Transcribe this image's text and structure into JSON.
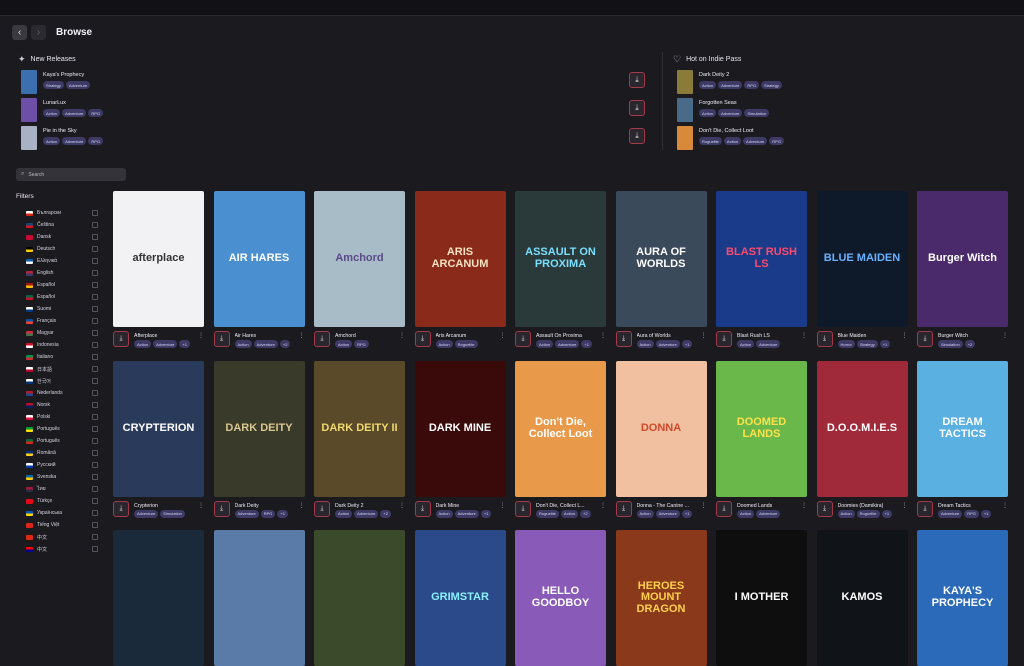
{
  "header": {
    "title": "Browse",
    "back_icon": "‹",
    "forward_icon": "›"
  },
  "new_releases": {
    "title": "New Releases",
    "items": [
      {
        "title": "Kaya's Prophecy",
        "tags": [
          "Strategy",
          "Adventure"
        ],
        "color": "#3b6fb0"
      },
      {
        "title": "LunarLux",
        "tags": [
          "Action",
          "Adventure",
          "RPG"
        ],
        "color": "#6d4fa8"
      },
      {
        "title": "Pie in the Sky",
        "tags": [
          "Action",
          "Adventure",
          "RPG"
        ],
        "color": "#a8b2c4"
      }
    ]
  },
  "indie_pass": {
    "title": "Hot on Indie Pass",
    "items": [
      {
        "title": "Dark Deity 2",
        "tags": [
          "Action",
          "Adventure",
          "RPG",
          "Strategy"
        ],
        "color": "#8b7b3a"
      },
      {
        "title": "Forgotten Seas",
        "tags": [
          "Action",
          "Adventure",
          "Simulation"
        ],
        "color": "#4a6a8a"
      },
      {
        "title": "Don't Die, Collect Loot",
        "tags": [
          "Roguelite",
          "Action",
          "Adventure",
          "RPG"
        ],
        "color": "#d88a3a"
      }
    ]
  },
  "search": {
    "placeholder": "Search"
  },
  "filters": {
    "title": "Filters",
    "languages": [
      {
        "label": "Български",
        "c1": "#ffffff",
        "c2": "#d62612"
      },
      {
        "label": "Čeština",
        "c1": "#11457e",
        "c2": "#d7141a"
      },
      {
        "label": "Dansk",
        "c1": "#c60c30",
        "c2": "#c60c30"
      },
      {
        "label": "Deutsch",
        "c1": "#000000",
        "c2": "#ffce00"
      },
      {
        "label": "Ελληνικά",
        "c1": "#0d5eaf",
        "c2": "#ffffff"
      },
      {
        "label": "English",
        "c1": "#b22234",
        "c2": "#3c3b6e"
      },
      {
        "label": "Español",
        "c1": "#aa151b",
        "c2": "#f1bf00"
      },
      {
        "label": "Español",
        "c1": "#006847",
        "c2": "#ce1126"
      },
      {
        "label": "Suomi",
        "c1": "#ffffff",
        "c2": "#003580"
      },
      {
        "label": "Français",
        "c1": "#0055a4",
        "c2": "#ef4135"
      },
      {
        "label": "Magyar",
        "c1": "#ce2939",
        "c2": "#477050"
      },
      {
        "label": "Indonesia",
        "c1": "#ce1126",
        "c2": "#ffffff"
      },
      {
        "label": "Italiano",
        "c1": "#009246",
        "c2": "#ce2b37"
      },
      {
        "label": "日本語",
        "c1": "#ffffff",
        "c2": "#bc002d"
      },
      {
        "label": "한국어",
        "c1": "#ffffff",
        "c2": "#003478"
      },
      {
        "label": "Nederlands",
        "c1": "#ae1c28",
        "c2": "#21468b"
      },
      {
        "label": "Norsk",
        "c1": "#ba0c2f",
        "c2": "#00205b"
      },
      {
        "label": "Polski",
        "c1": "#ffffff",
        "c2": "#dc143c"
      },
      {
        "label": "Português",
        "c1": "#009c3b",
        "c2": "#ffdf00"
      },
      {
        "label": "Português",
        "c1": "#046a38",
        "c2": "#da291c"
      },
      {
        "label": "Română",
        "c1": "#002b7f",
        "c2": "#fcd116"
      },
      {
        "label": "Русский",
        "c1": "#ffffff",
        "c2": "#0039a6"
      },
      {
        "label": "Svenska",
        "c1": "#006aa7",
        "c2": "#fecc00"
      },
      {
        "label": "ไทย",
        "c1": "#a51931",
        "c2": "#2d2a4a"
      },
      {
        "label": "Türkçe",
        "c1": "#e30a17",
        "c2": "#e30a17"
      },
      {
        "label": "Українська",
        "c1": "#0057b7",
        "c2": "#ffd700"
      },
      {
        "label": "Tiếng Việt",
        "c1": "#da251d",
        "c2": "#da251d"
      },
      {
        "label": "中文",
        "c1": "#de2910",
        "c2": "#de2910"
      },
      {
        "label": "中文",
        "c1": "#fe0000",
        "c2": "#000095"
      }
    ]
  },
  "games": [
    {
      "title": "Afterplace",
      "cover_text": "afterplace",
      "tags": [
        "Action",
        "Adventure",
        "+1"
      ],
      "bg": "#f2f2f4",
      "fg": "#333333"
    },
    {
      "title": "Air Hares",
      "cover_text": "AIR HARES",
      "tags": [
        "Action",
        "Adventure",
        "+2"
      ],
      "bg": "#4a8fd0",
      "fg": "#ffffff"
    },
    {
      "title": "Amchord",
      "cover_text": "Amchord",
      "tags": [
        "Action",
        "RPG"
      ],
      "bg": "#a8bcc8",
      "fg": "#5a4a8a"
    },
    {
      "title": "Aris Arcanum",
      "cover_text": "ARIS ARCANUM",
      "tags": [
        "Action",
        "Roguelite"
      ],
      "bg": "#8a2a1a",
      "fg": "#f4e2c0"
    },
    {
      "title": "Assault On Proxima",
      "cover_text": "ASSAULT ON PROXIMA",
      "tags": [
        "Action",
        "Adventure",
        "+1"
      ],
      "bg": "#2a3a3a",
      "fg": "#7adfff"
    },
    {
      "title": "Aura of Worlds",
      "cover_text": "AURA OF WORLDS",
      "tags": [
        "Action",
        "Adventure",
        "+1"
      ],
      "bg": "#3a4a5a",
      "fg": "#ffffff"
    },
    {
      "title": "Blast Rush LS",
      "cover_text": "BLAST RUSH LS",
      "tags": [
        "Action",
        "Adventure"
      ],
      "bg": "#1a3a8a",
      "fg": "#ff4a6a"
    },
    {
      "title": "Blue Maiden",
      "cover_text": "BLUE MAIDEN",
      "tags": [
        "Horror",
        "Strategy",
        "+1"
      ],
      "bg": "#0e1a2a",
      "fg": "#6ab0ff"
    },
    {
      "title": "Burger Witch",
      "cover_text": "Burger Witch",
      "tags": [
        "Simulation",
        "+2"
      ],
      "bg": "#4a2a6a",
      "fg": "#ffffff"
    },
    {
      "title": "Crypterion",
      "cover_text": "CRYPTERION",
      "tags": [
        "Adventure",
        "Simulation"
      ],
      "bg": "#2a3a5a",
      "fg": "#ffffff"
    },
    {
      "title": "Dark Deity",
      "cover_text": "DARK DEITY",
      "tags": [
        "Adventure",
        "RPG",
        "+1"
      ],
      "bg": "#3a3a2a",
      "fg": "#d8c890"
    },
    {
      "title": "Dark Deity 2",
      "cover_text": "DARK DEITY II",
      "tags": [
        "Action",
        "Adventure",
        "+2"
      ],
      "bg": "#5a4a2a",
      "fg": "#f0d870"
    },
    {
      "title": "Dark Mine",
      "cover_text": "DARK MINE",
      "tags": [
        "Action",
        "Adventure",
        "+1"
      ],
      "bg": "#3a0a0a",
      "fg": "#ffffff"
    },
    {
      "title": "Don't Die, Collect L...",
      "cover_text": "Don't Die, Collect Loot",
      "tags": [
        "Roguelite",
        "Action",
        "+2"
      ],
      "bg": "#e89a4a",
      "fg": "#ffffff"
    },
    {
      "title": "Donna - The Canine ...",
      "cover_text": "DONNA",
      "tags": [
        "Action",
        "Adventure",
        "+1"
      ],
      "bg": "#f0c0a0",
      "fg": "#d04a2a"
    },
    {
      "title": "Doomed Lands",
      "cover_text": "DOOMED LANDS",
      "tags": [
        "Action",
        "Adventure"
      ],
      "bg": "#6ab84a",
      "fg": "#ffe04a"
    },
    {
      "title": "Doomies (Damikira)",
      "cover_text": "D.O.O.M.I.E.S",
      "tags": [
        "Action",
        "Roguelite",
        "+1"
      ],
      "bg": "#a02a3a",
      "fg": "#ffffff"
    },
    {
      "title": "Dream Tactics",
      "cover_text": "DREAM TACTICS",
      "tags": [
        "Adventure",
        "RPG",
        "+1"
      ],
      "bg": "#5ab0e0",
      "fg": "#ffffff"
    },
    {
      "title": "",
      "cover_text": "",
      "tags": [],
      "bg": "#1a2a3a",
      "fg": "#ffffff"
    },
    {
      "title": "",
      "cover_text": "",
      "tags": [],
      "bg": "#5a7aa8",
      "fg": "#ffffff"
    },
    {
      "title": "",
      "cover_text": "",
      "tags": [],
      "bg": "#3a4a2a",
      "fg": "#ffffff"
    },
    {
      "title": "",
      "cover_text": "GRIMSTAR",
      "tags": [],
      "bg": "#2a4a8a",
      "fg": "#8af0ff"
    },
    {
      "title": "",
      "cover_text": "HELLO GOODBOY",
      "tags": [],
      "bg": "#8a5ab8",
      "fg": "#ffffff"
    },
    {
      "title": "",
      "cover_text": "HEROES MOUNT DRAGON",
      "tags": [],
      "bg": "#8a3a1a",
      "fg": "#ffd04a"
    },
    {
      "title": "",
      "cover_text": "I MOTHER",
      "tags": [],
      "bg": "#0e0e0e",
      "fg": "#ffffff"
    },
    {
      "title": "",
      "cover_text": "KAMOS",
      "tags": [],
      "bg": "#101418",
      "fg": "#ffffff"
    },
    {
      "title": "",
      "cover_text": "KAYA'S PROPHECY",
      "tags": [],
      "bg": "#2a6ab8",
      "fg": "#ffffff"
    }
  ]
}
